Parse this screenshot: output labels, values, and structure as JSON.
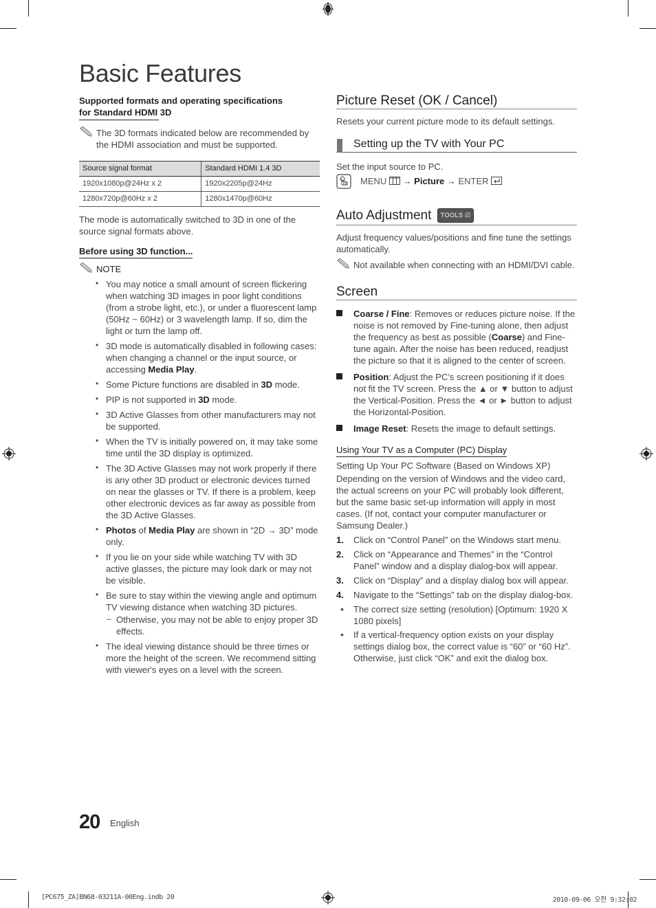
{
  "page": {
    "title": "Basic Features",
    "page_number": "20",
    "language": "English"
  },
  "left": {
    "formats_heading": "Supported formats and operating specifications for Standard HDMI 3D",
    "formats_note": "The 3D formats indicated below are recommended by the HDMI association and must be supported.",
    "table": {
      "headers": [
        "Source signal format",
        "Standard HDMI 1.4 3D"
      ],
      "rows": [
        [
          "1920x1080p@24Hz x 2",
          "1920x2205p@24Hz"
        ],
        [
          "1280x720p@60Hz x 2",
          "1280x1470p@60Hz"
        ]
      ]
    },
    "mode_text": "The mode is automatically switched to 3D in one of the source signal formats above.",
    "before_heading": "Before using 3D function...",
    "note_label": "NOTE",
    "bullets": {
      "b1": "You may notice a small amount of screen flickering when watching 3D images in poor light conditions (from a strobe light, etc.), or under a fluorescent lamp (50Hz ~ 60Hz) or 3 wavelength lamp. If so, dim the light or turn the lamp off.",
      "b2_pre": "3D mode is automatically disabled in following cases: when changing a channel or the input source, or accessing ",
      "b2_bold": "Media Play",
      "b2_post": ".",
      "b3_pre": "Some Picture functions are disabled in ",
      "b3_bold": "3D",
      "b3_post": " mode.",
      "b4_pre": "PIP is not supported in ",
      "b4_bold": "3D",
      "b4_post": " mode.",
      "b5": "3D Active Glasses from other manufacturers may not be supported.",
      "b6": "When the TV is initially powered on, it may take some time until the 3D display is optimized.",
      "b7": "The 3D Active Glasses may not work properly if there is any other 3D product or electronic devices turned on near the glasses or TV. If there is a problem, keep other electronic devices as far away as possible from the 3D Active Glasses.",
      "b8_bold1": "Photos",
      "b8_mid": " of ",
      "b8_bold2": "Media Play",
      "b8_post": " are shown in “2D → 3D” mode only.",
      "b9": "If you lie on your side while watching TV with 3D active glasses, the picture may look dark or may not be visible.",
      "b10": "Be sure to stay within the viewing angle and optimum TV viewing distance when watching 3D pictures.",
      "b10_sub": "Otherwise, you may not be able to enjoy proper 3D effects.",
      "b11": "The ideal viewing distance should be three times or more the height of the screen. We recommend sitting with viewer's eyes on a level with the screen."
    }
  },
  "right": {
    "picture_reset": {
      "heading": "Picture Reset (OK / Cancel)",
      "text": "Resets your current picture mode to its default settings."
    },
    "pc_setup": {
      "heading": "Setting up the TV with Your PC",
      "text": "Set the input source to PC.",
      "menu": "MENU",
      "arrow": "→",
      "picture": "Picture",
      "enter": "ENTER"
    },
    "auto_adjustment": {
      "heading": "Auto Adjustment",
      "badge": "TOOLS",
      "text": "Adjust frequency values/positions and fine tune the settings automatically.",
      "note": "Not available when connecting with an HDMI/DVI cable."
    },
    "screen": {
      "heading": "Screen",
      "items": {
        "coarse_label": "Coarse / Fine",
        "coarse_pre": ": Removes or reduces picture noise. If the noise is not removed by Fine-tuning alone, then adjust the frequency as best as possible (",
        "coarse_bold": "Coarse",
        "coarse_post": ") and Fine-tune again. After the noise has been reduced, readjust the picture so that it is aligned to the center of screen.",
        "position_label": "Position",
        "position_text": ": Adjust the PC’s screen positioning if it does not fit the TV screen. Press the ▲ or ▼ button to adjust the Vertical-Position. Press the ◄ or ► button to adjust the Horizontal-Position.",
        "reset_label": "Image Reset",
        "reset_text": ": Resets the image to default settings."
      }
    },
    "pc_display": {
      "heading": "Using Your TV as a Computer (PC) Display",
      "subtitle": "Setting Up Your PC Software (Based on Windows XP)",
      "intro": "Depending on the version of Windows and the video card, the actual screens on your PC will probably look different, but the same basic set-up information will apply in most cases. (If not, contact your computer manufacturer or Samsung Dealer.)",
      "steps": [
        {
          "num": "1.",
          "text": "Click on “Control Panel” on the Windows start menu."
        },
        {
          "num": "2.",
          "text": "Click on “Appearance and Themes” in the “Control Panel” window and a display dialog-box will appear."
        },
        {
          "num": "3.",
          "text": "Click on “Display” and a display dialog box will appear."
        },
        {
          "num": "4.",
          "text": "Navigate to the “Settings” tab on the display dialog-box."
        }
      ],
      "dots": [
        "The correct size setting (resolution) [Optimum: 1920 X 1080 pixels]",
        "If a vertical-frequency option exists on your display settings dialog box, the correct value is “60” or “60 Hz”. Otherwise, just click “OK” and exit the dialog box."
      ]
    }
  },
  "slug": {
    "file": "[PC675_ZA]BN68-03211A-00Eng.indb   20",
    "datetime": "2010-09-06   오전 9:32:02"
  }
}
